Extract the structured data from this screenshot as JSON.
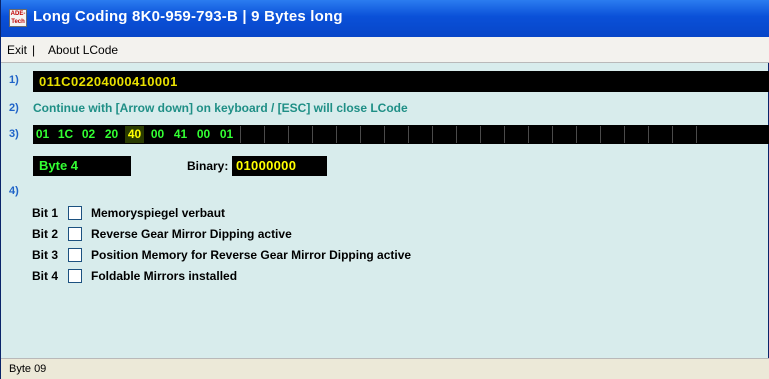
{
  "window": {
    "title": "Long Coding  8K0-959-793-B  |  9 Bytes long",
    "icon": "app-logo-icon",
    "icon_text": "ADE-Tech"
  },
  "menu": {
    "items": [
      "Exit",
      "About LCode"
    ],
    "separator": "|"
  },
  "sections": {
    "row1_num": "1)",
    "row2_num": "2)",
    "row3_num": "3)",
    "row4_num": "4)"
  },
  "coding": {
    "value": "011C02204000410001",
    "hint": "Continue with [Arrow down] on keyboard / [ESC] will close LCode"
  },
  "bytes": {
    "values": [
      "01",
      "1C",
      "02",
      "20",
      "40",
      "00",
      "41",
      "00",
      "01"
    ],
    "selected_index": 4,
    "empty_slots": 20
  },
  "byte_detail": {
    "label": "Byte 4",
    "binary_label": "Binary:",
    "binary_value": "01000000"
  },
  "bits": [
    {
      "label": "Bit 1",
      "text": "Memoryspiegel verbaut",
      "checked": false
    },
    {
      "label": "Bit 2",
      "text": "Reverse Gear Mirror Dipping active",
      "checked": false
    },
    {
      "label": "Bit 3",
      "text": "Position Memory for Reverse Gear Mirror Dipping active",
      "checked": false
    },
    {
      "label": "Bit 4",
      "text": "Foldable Mirrors installed",
      "checked": false
    }
  ],
  "status": {
    "text": "Byte 09"
  },
  "colors": {
    "background": "#d8ecec",
    "code_text": "#e8e000",
    "byte_text": "#33ff33",
    "hint_text": "#1f8f86",
    "section_num": "#1f63c8"
  }
}
